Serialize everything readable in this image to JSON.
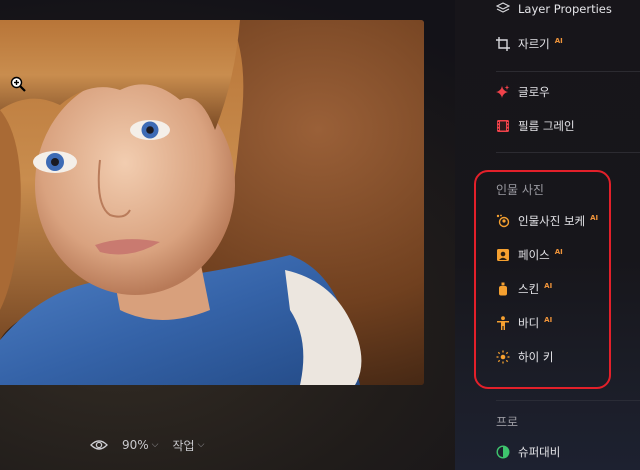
{
  "panel": {
    "items_top": [
      {
        "label": "Layer Properties",
        "icon": "layers-icon",
        "ai": ""
      },
      {
        "label": "자르기",
        "icon": "crop-icon",
        "ai": "AI"
      }
    ],
    "items_creative": [
      {
        "label": "글로우",
        "icon": "sparkle-icon",
        "ai": ""
      },
      {
        "label": "필름 그레인",
        "icon": "film-icon",
        "ai": ""
      }
    ],
    "portrait": {
      "title": "인물 사진",
      "items": [
        {
          "label": "인물사진 보케",
          "icon": "bokeh-icon",
          "ai": "AI"
        },
        {
          "label": "페이스",
          "icon": "face-icon",
          "ai": "AI"
        },
        {
          "label": "스킨",
          "icon": "skin-icon",
          "ai": "AI"
        },
        {
          "label": "바디",
          "icon": "body-icon",
          "ai": "AI"
        },
        {
          "label": "하이 키",
          "icon": "high-key-icon",
          "ai": ""
        }
      ]
    },
    "pro": {
      "title": "프로",
      "items": [
        {
          "label": "슈퍼대비",
          "icon": "contrast-icon",
          "ai": ""
        }
      ]
    }
  },
  "toolbar": {
    "eye_icon": "eye-icon",
    "zoom": "90%",
    "actions_label": "작업"
  },
  "colors": {
    "highlight": "#e3202a",
    "ai_badge": "#f0943a",
    "icon_red": "#f0424a",
    "icon_orange": "#f5a030",
    "icon_green": "#3ec46d"
  }
}
